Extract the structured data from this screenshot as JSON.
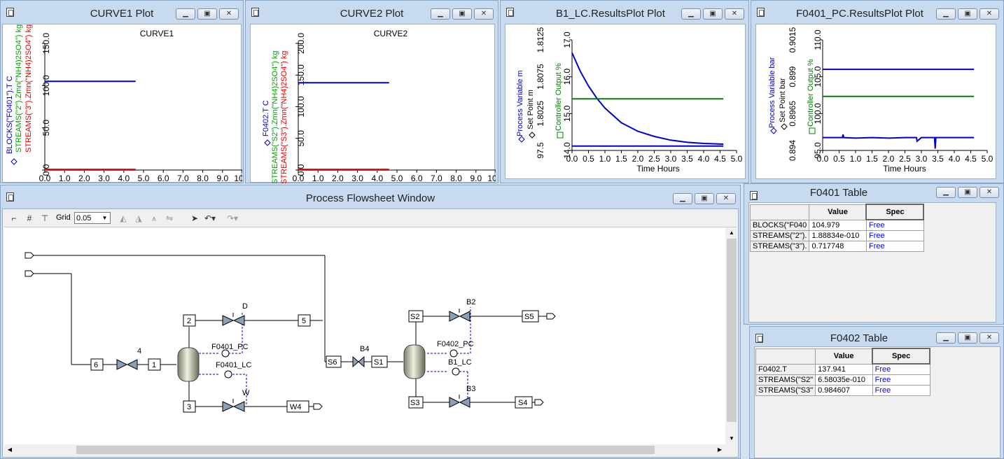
{
  "windows": {
    "curve1": {
      "title": "CURVE1 Plot",
      "plot_title": "CURVE1",
      "ylabels": [
        {
          "text": "BLOCKS(\"F0401\").T C",
          "color": "#0000c8"
        },
        {
          "text": "STREAMS(\"2\").Zmn(\"NH4)2SO4\") kg/",
          "color": "#00a000"
        },
        {
          "text": "STREAMS(\"3\").Zmn(\"NH4)2SO4\") kg/",
          "color": "#e00000"
        }
      ],
      "yticks": [
        "0.0",
        "50.0",
        "100.0",
        "150.0"
      ],
      "xticks": [
        "0.0",
        "1.0",
        "2.0",
        "3.0",
        "4.0",
        "5.0",
        "6.0",
        "7.0",
        "8.0",
        "9.0",
        "10.0"
      ],
      "xlabel": "Time Hours"
    },
    "curve2": {
      "title": "CURVE2 Plot",
      "plot_title": "CURVE2",
      "ylabels": [
        {
          "text": "F0402.T C",
          "color": "#0000c8"
        },
        {
          "text": "STREAMS(\"S2\").Zmn(\"NH4)2SO4\") kg",
          "color": "#00a000"
        },
        {
          "text": "STREAMS(\"S3\").Zmn(\"NH4)2SO4\") kg",
          "color": "#e00000"
        }
      ],
      "yticks": [
        "0.0",
        "50.0",
        "100.0",
        "150.0",
        "200.0"
      ],
      "xticks": [
        "0.0",
        "1.0",
        "2.0",
        "3.0",
        "4.0",
        "5.0",
        "6.0",
        "7.0",
        "8.0",
        "9.0",
        "10.0"
      ]
    },
    "b1lc": {
      "title": "B1_LC.ResultsPlot Plot",
      "ylabels": [
        {
          "text": "Process Variable m",
          "color": "#0000c8"
        },
        {
          "text": "Set Point m",
          "color": "#000000"
        },
        {
          "text": "Controller Output %",
          "color": "#008000"
        }
      ],
      "yticks_a": [
        "97.5",
        "1.8025",
        "1.8075",
        "1.8125"
      ],
      "yticks_b": [
        "14.0",
        "15.0",
        "16.0",
        "17.0"
      ],
      "xticks": [
        "0.0",
        "0.5",
        "1.0",
        "1.5",
        "2.0",
        "2.5",
        "3.0",
        "3.5",
        "4.0",
        "4.5",
        "5.0"
      ],
      "xlabel": "Time Hours"
    },
    "f0401pc": {
      "title": "F0401_PC.ResultsPlot Plot",
      "ylabels": [
        {
          "text": "Process Variable bar",
          "color": "#0000c8"
        },
        {
          "text": "Set Point bar",
          "color": "#000000"
        },
        {
          "text": "Controller Output %",
          "color": "#008000"
        }
      ],
      "yticks_a": [
        "0.894",
        "0.8965",
        "0.899",
        "0.9015"
      ],
      "yticks_b": [
        "95.0",
        "100.0",
        "105.0",
        "110.0"
      ],
      "xticks": [
        "0.0",
        "0.5",
        "1.0",
        "1.5",
        "2.0",
        "2.5",
        "3.0",
        "3.5",
        "4.0",
        "4.5",
        "5.0"
      ],
      "xlabel": "Time Hours"
    },
    "flowsheet": {
      "title": "Process Flowsheet Window",
      "grid_label": "Grid",
      "grid_value": "0.05",
      "blocks": [
        "4",
        "F0401_LC",
        "F0401_PC",
        "D",
        "W",
        "B4",
        "F0402_PC",
        "B1_LC",
        "B2",
        "B3"
      ],
      "streams": [
        "6",
        "1",
        "2",
        "3",
        "5",
        "W4",
        "S6",
        "S1",
        "S2",
        "S3",
        "S5",
        "S4"
      ]
    },
    "f0401table": {
      "title": "F0401 Table",
      "headers": [
        "Value",
        "Spec"
      ],
      "rows": [
        {
          "name": "BLOCKS(\"F040",
          "value": "104.979",
          "spec": "Free"
        },
        {
          "name": "STREAMS(\"2\").",
          "value": "1.88834e-010",
          "spec": "Free"
        },
        {
          "name": "STREAMS(\"3\").",
          "value": "0.717748",
          "spec": "Free"
        }
      ]
    },
    "f0402table": {
      "title": "F0402 Table",
      "headers": [
        "Value",
        "Spec"
      ],
      "rows": [
        {
          "name": "F0402.T",
          "value": "137.941",
          "spec": "Free"
        },
        {
          "name": "STREAMS(\"S2\"",
          "value": "6.58035e-010",
          "spec": "Free"
        },
        {
          "name": "STREAMS(\"S3\"",
          "value": "0.984607",
          "spec": "Free"
        }
      ]
    }
  },
  "chart_data": [
    {
      "type": "line",
      "title": "CURVE1",
      "xlim": [
        0,
        10
      ],
      "ylim": [
        0,
        150
      ],
      "series": [
        {
          "name": "BLOCKS(\"F0401\").T C",
          "x": [
            0,
            4.6
          ],
          "y": [
            104.98,
            104.98
          ]
        },
        {
          "name": "STREAMS(\"2\").Zmn(\"NH4)2SO4\") kg/",
          "x": [
            0,
            4.6
          ],
          "y": [
            0,
            0
          ]
        },
        {
          "name": "STREAMS(\"3\").Zmn(\"NH4)2SO4\") kg/",
          "x": [
            0,
            4.6
          ],
          "y": [
            0.72,
            0.72
          ]
        }
      ]
    },
    {
      "type": "line",
      "title": "CURVE2",
      "xlim": [
        0,
        10
      ],
      "ylim": [
        0,
        200
      ],
      "series": [
        {
          "name": "F0402.T C",
          "x": [
            0,
            4.6
          ],
          "y": [
            137.94,
            137.94
          ]
        },
        {
          "name": "STREAMS(\"S2\").Zmn(\"NH4)2SO4\") kg",
          "x": [
            0,
            4.6
          ],
          "y": [
            0,
            0
          ]
        },
        {
          "name": "STREAMS(\"S3\").Zmn(\"NH4)2SO4\") kg",
          "x": [
            0,
            4.6
          ],
          "y": [
            0.98,
            0.98
          ]
        }
      ]
    },
    {
      "type": "line",
      "title": "",
      "xlim": [
        0,
        5
      ],
      "ylim": [
        14,
        17
      ],
      "series": [
        {
          "name": "Process Variable m",
          "x": [
            0,
            0.25,
            0.5,
            0.75,
            1.0,
            1.5,
            2.0,
            2.5,
            3.0,
            3.5,
            4.0,
            4.6
          ],
          "y": [
            16.65,
            16.15,
            15.75,
            15.42,
            15.15,
            14.75,
            14.52,
            14.38,
            14.28,
            14.22,
            14.19,
            14.17
          ]
        },
        {
          "name": "Set Point m",
          "x": [
            0,
            4.6
          ],
          "y": [
            14.12,
            14.12
          ]
        },
        {
          "name": "Controller Output %",
          "x": [
            0,
            4.6
          ],
          "y": [
            15.4,
            15.4
          ]
        }
      ]
    },
    {
      "type": "line",
      "title": "",
      "xlim": [
        0,
        5
      ],
      "ylim": [
        92,
        110
      ],
      "series": [
        {
          "name": "Process Variable bar",
          "x": [
            0,
            0.6,
            0.62,
            0.64,
            1.0,
            1.5,
            2.0,
            2.5,
            2.85,
            2.87,
            3.0,
            3.4,
            3.42,
            3.44,
            3.8,
            4.6
          ],
          "y": [
            94.1,
            94.1,
            94.6,
            94.1,
            94.0,
            94.1,
            94.0,
            94.1,
            94.1,
            93.5,
            94.1,
            94.1,
            92.3,
            94.1,
            94.1,
            94.1
          ]
        },
        {
          "name": "Set Point bar",
          "x": [
            0,
            4.6
          ],
          "y": [
            105.2,
            105.2
          ]
        },
        {
          "name": "Controller Output %",
          "x": [
            0,
            4.6
          ],
          "y": [
            100.8,
            100.8
          ]
        }
      ]
    }
  ]
}
